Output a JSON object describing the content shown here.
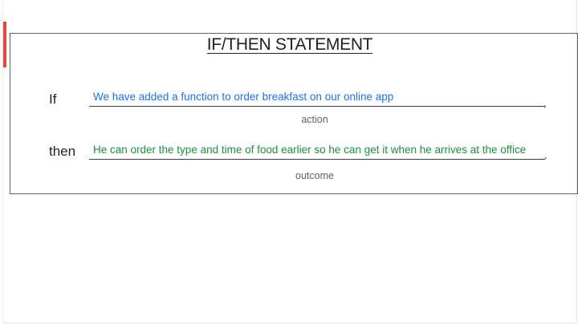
{
  "slide": {
    "title": "IF/THEN STATEMENT",
    "if_row": {
      "label": "If",
      "answer": "We have added a function to order breakfast on our online app",
      "caption": "action",
      "trailing_punct": ","
    },
    "then_row": {
      "label": "then",
      "answer": "He can order the type and time of food earlier so he can get it when he arrives at the office",
      "caption": "outcome",
      "trailing_punct": "."
    }
  },
  "colors": {
    "accent": "#e8453c",
    "action_text": "#1a73e8",
    "outcome_text": "#1e8e3e"
  }
}
